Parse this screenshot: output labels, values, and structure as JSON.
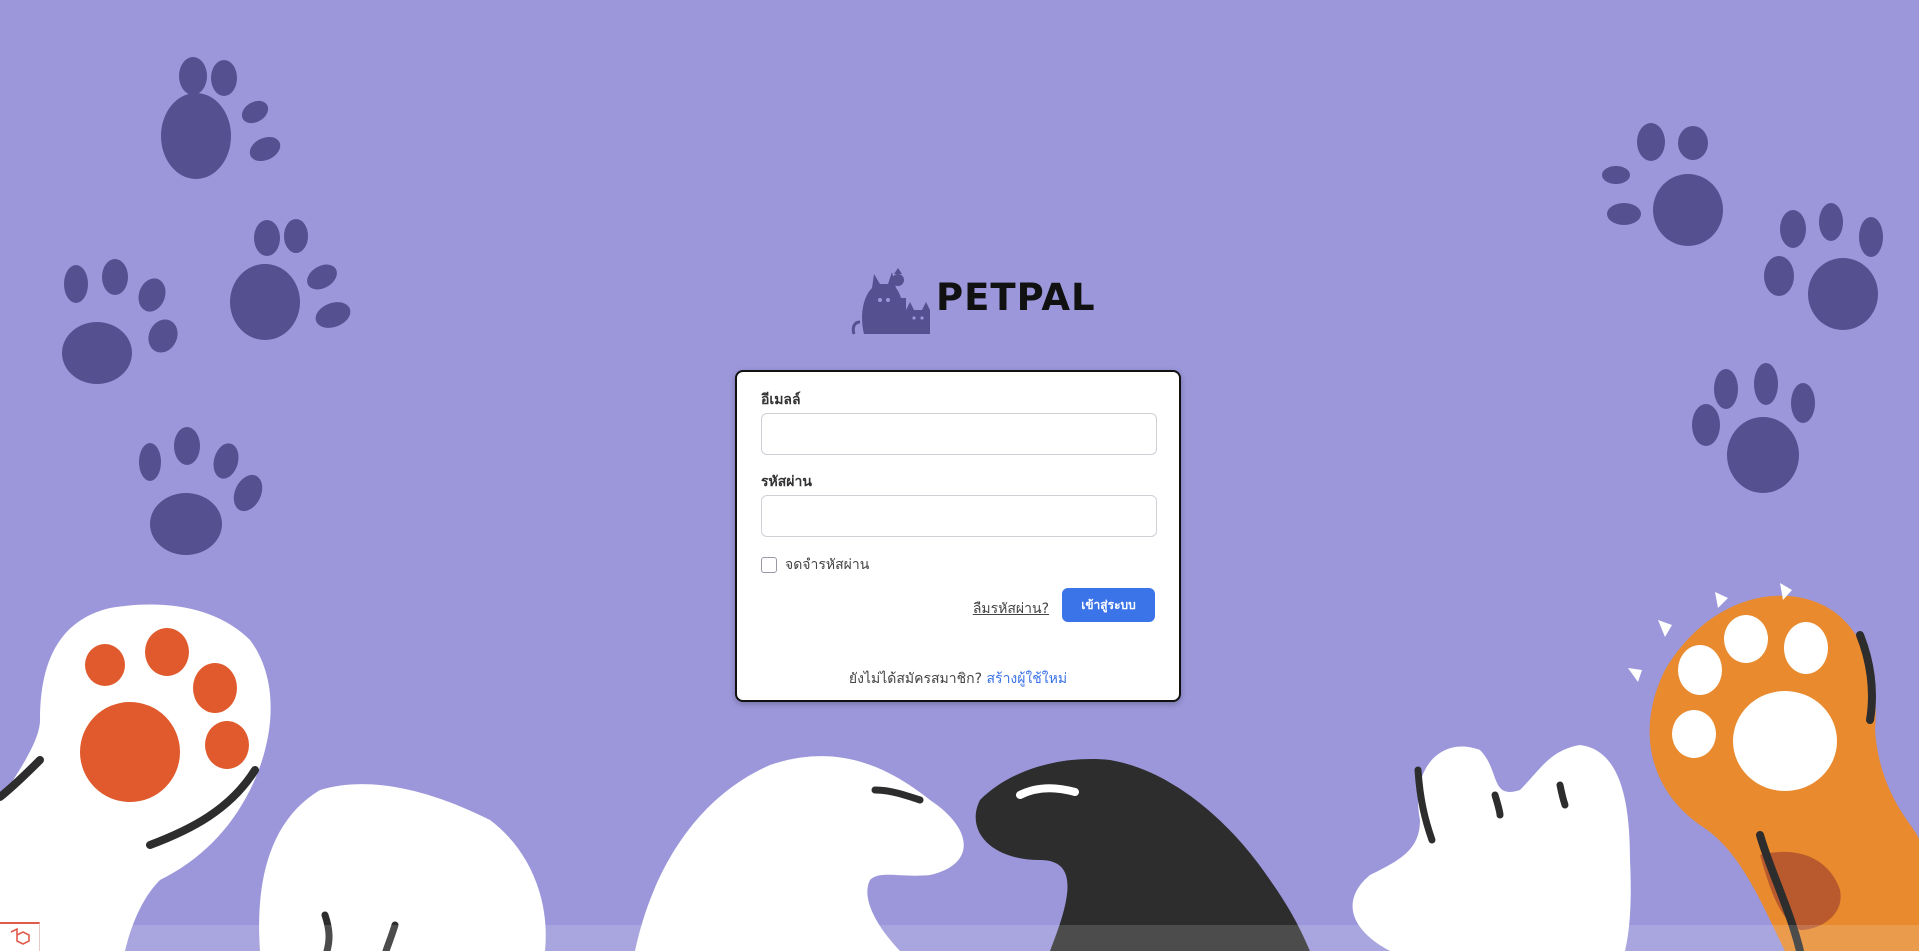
{
  "brand": {
    "name": "PETPAL",
    "logo_icon": "pets-logo-icon"
  },
  "login_form": {
    "email_label": "อีเมลล์",
    "email_value": "",
    "password_label": "รหัสผ่าน",
    "password_value": "",
    "remember_label": "จดจำรหัสผ่าน",
    "remember_checked": false,
    "forgot_label": "ลืมรหัสผ่าน?",
    "submit_label": "เข้าสู่ระบบ"
  },
  "signup": {
    "prompt": "ยังไม่ได้สมัครสมาชิก?",
    "link_label": "สร้างผู้ใช้ใหม่"
  },
  "colors": {
    "background": "#9b97da",
    "paw_print": "#55508f",
    "accent_button": "#3b73e8",
    "link": "#3b73e8"
  },
  "corner_badge_icon": "framework-logo-icon"
}
